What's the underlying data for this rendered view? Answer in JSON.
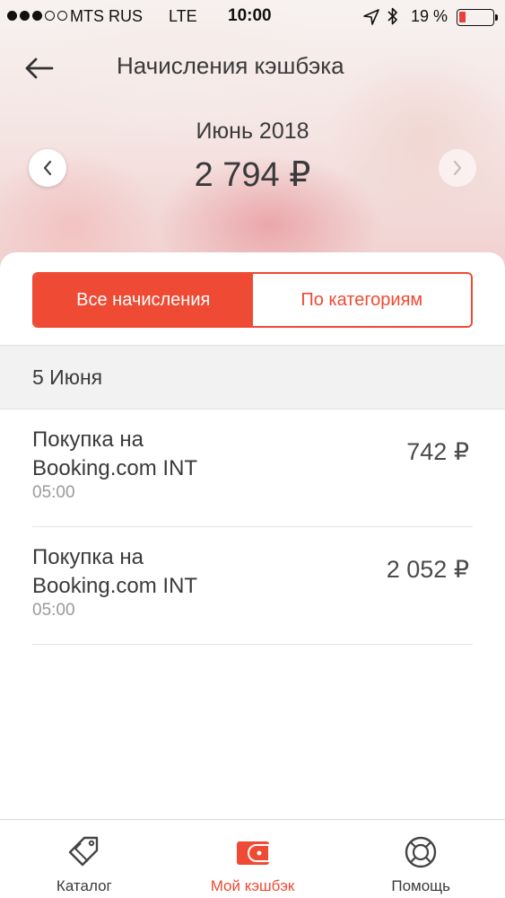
{
  "status_bar": {
    "carrier": "MTS RUS",
    "network": "LTE",
    "time": "10:00",
    "battery_percent": "19 %",
    "battery_level": 0.19
  },
  "header": {
    "title": "Начисления кэшбэка",
    "period": "Июнь 2018",
    "amount": "2 794 ₽"
  },
  "segments": {
    "all": "Все начисления",
    "categories": "По категориям"
  },
  "date_group": "5 Июня",
  "transactions": [
    {
      "title_line1": "Покупка на",
      "title_line2": "Booking.com INT",
      "time": "05:00",
      "amount": "742 ₽"
    },
    {
      "title_line1": "Покупка на",
      "title_line2": "Booking.com INT",
      "time": "05:00",
      "amount": "2 052 ₽"
    }
  ],
  "tabbar": {
    "catalog": "Каталог",
    "my_cashback": "Мой кэшбэк",
    "help": "Помощь"
  },
  "colors": {
    "accent": "#ef4a33",
    "battery_low": "#e8403a"
  }
}
